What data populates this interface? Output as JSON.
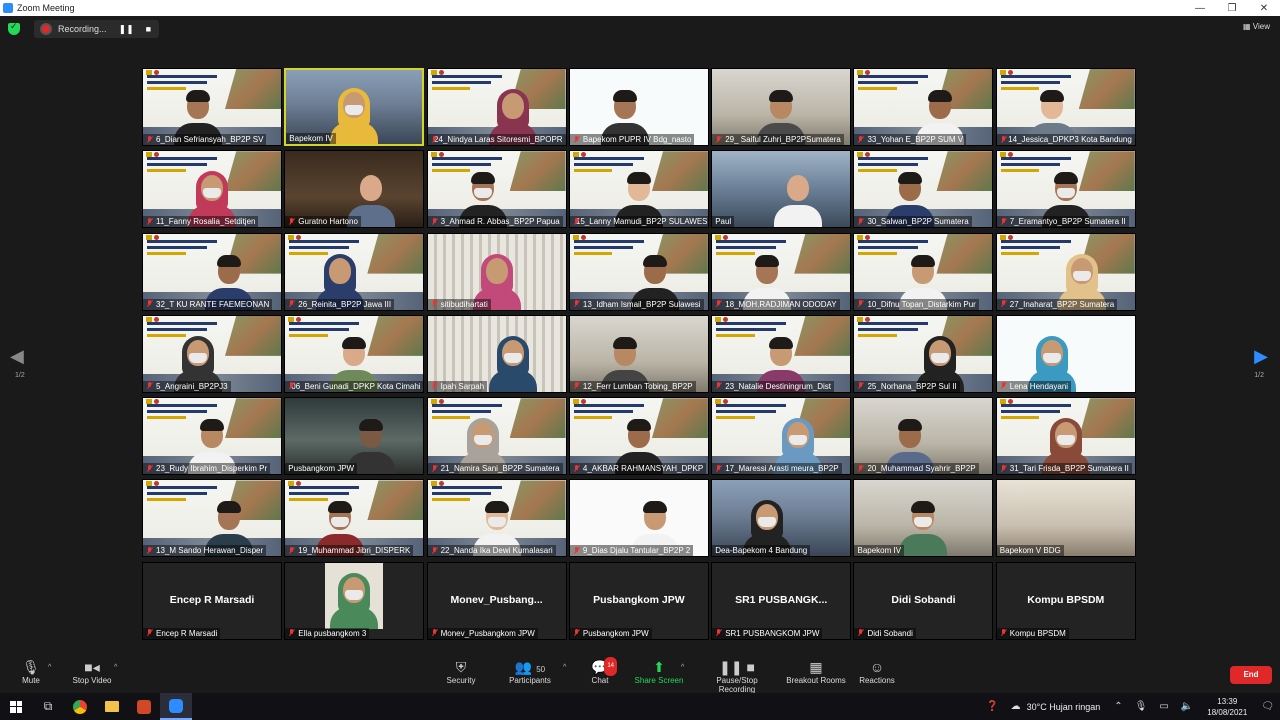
{
  "window": {
    "title": "Zoom Meeting",
    "controls": [
      "—",
      "❐",
      "✕"
    ]
  },
  "topbar": {
    "recording_label": "Recording...",
    "pause_icon": "pause-icon",
    "stop_icon": "stop-icon",
    "view_label": "View"
  },
  "pagination": {
    "left": "1/2",
    "right": "1/2"
  },
  "tiles": [
    {
      "label": "6_Dian Sefriansyah_BP2P SV",
      "bg": "banner",
      "muted": true,
      "person": {
        "skin": "#a67555",
        "hair": true,
        "shirt": "#222"
      }
    },
    {
      "label": "Bapekom IV",
      "bg": "building",
      "muted": false,
      "active": true,
      "person": {
        "skin": "#c79a74",
        "hijab": "#e8b93a",
        "shirt": "#e8b93a",
        "mask": true
      }
    },
    {
      "label": "24_Nindya Laras Sitoresmi_BPOPR",
      "bg": "banner",
      "muted": true,
      "person": {
        "skin": "#c79a74",
        "hijab": "#8a3550",
        "shirt": "#8a3550"
      }
    },
    {
      "label": "Bapekom PUPR IV Bdg_nasto",
      "bg": "slide",
      "muted": true,
      "person": {
        "skin": "#a67555",
        "hair": true,
        "shirt": "#333"
      }
    },
    {
      "label": "29_ Saiful Zuhri_BP2PSumatera",
      "bg": "room",
      "muted": true,
      "person": {
        "skin": "#b88863",
        "hair": true,
        "shirt": "#4a4a4a"
      }
    },
    {
      "label": "33_Yohan E_BP2P SUM V",
      "bg": "banner",
      "muted": true,
      "person": {
        "skin": "#9c6b4a",
        "hair": true,
        "shirt": "#f2f2f2"
      }
    },
    {
      "label": "14_Jessica_DPKP3 Kota Bandung",
      "bg": "banner",
      "muted": true,
      "person": {
        "skin": "#e2b896",
        "hair": true,
        "shirt": "#6c7a8a"
      }
    },
    {
      "label": "11_Fanny Rosalia_Setditjen",
      "bg": "banner",
      "muted": true,
      "person": {
        "skin": "#c79a74",
        "hijab": "#c23a5a",
        "shirt": "#c23a5a",
        "mask": true
      }
    },
    {
      "label": "Guratno Hartono",
      "bg": "dark",
      "muted": true,
      "person": {
        "skin": "#d9a98a",
        "hair": false,
        "shirt": "#5d6f8a"
      }
    },
    {
      "label": "3_Ahmad R. Abbas_BP2P Papua",
      "bg": "banner",
      "muted": true,
      "person": {
        "skin": "#a67555",
        "hair": true,
        "shirt": "#222",
        "mask": true
      }
    },
    {
      "label": "15_Lanny Mamudi_BP2P SULAWESI",
      "bg": "banner",
      "muted": true,
      "person": {
        "skin": "#e2b896",
        "hair": true,
        "shirt": "#222"
      }
    },
    {
      "label": "Paul",
      "bg": "city",
      "muted": false,
      "person": {
        "skin": "#d9a98a",
        "hair": false,
        "shirt": "#f2f2f2"
      }
    },
    {
      "label": "30_Salwan_BP2P Sumatera",
      "bg": "banner",
      "muted": true,
      "person": {
        "skin": "#9c6b4a",
        "hair": true,
        "shirt": "#2a3d6b"
      }
    },
    {
      "label": "7_Eramantyo_BP2P Sumatera II",
      "bg": "banner",
      "muted": true,
      "person": {
        "skin": "#a67555",
        "hair": true,
        "shirt": "#222",
        "mask": true
      }
    },
    {
      "label": "32_T KU RANTE FAEMEONAN",
      "bg": "banner",
      "muted": true,
      "person": {
        "skin": "#9c6b4a",
        "hair": true,
        "shirt": "#2a3d6b"
      }
    },
    {
      "label": "26_Reinita_BP2P Jawa III",
      "bg": "banner",
      "muted": true,
      "person": {
        "skin": "#c79a74",
        "hijab": "#2a3d6b",
        "shirt": "#2a3d6b"
      }
    },
    {
      "label": "sitibudihartati",
      "bg": "window",
      "muted": true,
      "person": {
        "skin": "#c79a74",
        "hijab": "#c24a7a",
        "shirt": "#c24a7a"
      }
    },
    {
      "label": "13_Idham Ismail_BP2P Sulawesi",
      "bg": "banner",
      "muted": true,
      "person": {
        "skin": "#9c6b4a",
        "hair": true,
        "shirt": "#222"
      }
    },
    {
      "label": "18_MOH.RADJIMAN ODODAY",
      "bg": "banner",
      "muted": true,
      "person": {
        "skin": "#a67555",
        "hair": true,
        "shirt": "#f2f2f2"
      }
    },
    {
      "label": "10_Difnu Topan_Distarkim Pur",
      "bg": "banner",
      "muted": true,
      "person": {
        "skin": "#c79a74",
        "hair": true,
        "shirt": "#f2f2f2"
      }
    },
    {
      "label": "27_Inaharat_BP2P Sumatera",
      "bg": "banner",
      "muted": true,
      "person": {
        "skin": "#c79a74",
        "hijab": "#e2c28a",
        "shirt": "#e2c28a",
        "mask": true
      }
    },
    {
      "label": "5_Angraini_BP2PJ3",
      "bg": "banner",
      "muted": true,
      "person": {
        "skin": "#c79a74",
        "hijab": "#333",
        "shirt": "#333",
        "mask": true
      }
    },
    {
      "label": "06_Beni Gunadi_DPKP Kota Cimahi",
      "bg": "banner",
      "muted": true,
      "person": {
        "skin": "#d9a98a",
        "hair": true,
        "shirt": "#6f8a5a"
      }
    },
    {
      "label": "Ipah Sarpah",
      "bg": "window",
      "muted": true,
      "person": {
        "skin": "#c79a74",
        "hijab": "#2a4a6b",
        "shirt": "#2a4a6b",
        "mask": true
      }
    },
    {
      "label": "12_Ferr Lumban Tobing_BP2P",
      "bg": "room",
      "muted": true,
      "person": {
        "skin": "#b88863",
        "hair": true,
        "shirt": "#444"
      }
    },
    {
      "label": "23_Natalie Destiningrum_Dist",
      "bg": "banner",
      "muted": true,
      "person": {
        "skin": "#c79a74",
        "hair": true,
        "shirt": "#8a3a6a"
      }
    },
    {
      "label": "25_Norhana_BP2P Sul II",
      "bg": "banner",
      "muted": true,
      "person": {
        "skin": "#c79a74",
        "hijab": "#222",
        "shirt": "#222",
        "mask": true
      }
    },
    {
      "label": "Lena Hendayani",
      "bg": "slide",
      "muted": true,
      "person": {
        "skin": "#c79a74",
        "hijab": "#3a9ac2",
        "shirt": "#3a9ac2",
        "mask": true
      }
    },
    {
      "label": "23_Rudy Ibrahim_Disperkim Pr",
      "bg": "banner",
      "muted": true,
      "person": {
        "skin": "#b88863",
        "hair": true,
        "shirt": "#f2f2f2"
      }
    },
    {
      "label": "Pusbangkom JPW",
      "bg": "room2",
      "muted": false,
      "person": {
        "skin": "#7a5a44",
        "hair": true,
        "shirt": "#333"
      }
    },
    {
      "label": "21_Namira Sani_BP2P Sumatera",
      "bg": "banner",
      "muted": true,
      "person": {
        "skin": "#c79a74",
        "hijab": "#a8a29a",
        "shirt": "#a8a29a",
        "mask": true
      }
    },
    {
      "label": "4_AKBAR RAHMANSYAH_DPKP",
      "bg": "banner",
      "muted": true,
      "person": {
        "skin": "#9c6b4a",
        "hair": true,
        "shirt": "#222"
      }
    },
    {
      "label": "17_Maressi Arasti meura_BP2P",
      "bg": "banner",
      "muted": true,
      "person": {
        "skin": "#c79a74",
        "hijab": "#6a9ac2",
        "shirt": "#6a9ac2",
        "mask": true
      }
    },
    {
      "label": "20_Muhammad Syahrir_BP2P",
      "bg": "room",
      "muted": true,
      "person": {
        "skin": "#9c6b4a",
        "hair": true,
        "shirt": "#5a6a8a"
      }
    },
    {
      "label": "31_Tari Frisda_BP2P Sumatera II",
      "bg": "banner",
      "muted": true,
      "person": {
        "skin": "#c79a74",
        "hijab": "#8a4a3a",
        "shirt": "#8a4a3a",
        "mask": true
      }
    },
    {
      "label": "13_M Sando Herawan_Disper",
      "bg": "banner",
      "muted": true,
      "person": {
        "skin": "#a67555",
        "hair": true,
        "shirt": "#2a3d4a"
      }
    },
    {
      "label": "19_Muhammad Jibri_DISPERK",
      "bg": "banner",
      "muted": true,
      "person": {
        "skin": "#a67555",
        "hair": true,
        "shirt": "#8a2a2a",
        "mask": true
      }
    },
    {
      "label": "22_Nanda Ika Dewi Kumalasari",
      "bg": "banner",
      "muted": true,
      "person": {
        "skin": "#e2b896",
        "hair": true,
        "shirt": "#f2f2f2",
        "mask": true
      }
    },
    {
      "label": "9_Dias Djalu Tantular_BP2P 2",
      "bg": "blank",
      "muted": true,
      "person": {
        "skin": "#c79a74",
        "hair": true,
        "shirt": "#f2f2f2"
      }
    },
    {
      "label": "Dea-Bapekom 4 Bandung",
      "bg": "building",
      "muted": false,
      "person": {
        "skin": "#c79a74",
        "hijab": "#222",
        "shirt": "#222",
        "mask": true
      }
    },
    {
      "label": "Bapekom IV",
      "bg": "room",
      "muted": false,
      "person": {
        "skin": "#b88863",
        "hair": true,
        "shirt": "#4a7a5a",
        "mask": true
      }
    },
    {
      "label": "Bapekom V BDG",
      "bg": "flags",
      "muted": false,
      "person": null
    },
    {
      "label": "Encep R Marsadi",
      "bg": "name",
      "muted": true,
      "center_name": "Encep R Marsadi",
      "person": null
    },
    {
      "label": "Ella pusbangkom 3",
      "bg": "name",
      "muted": true,
      "person": null,
      "inset": {
        "skin": "#c79a74",
        "hijab": "#4a8a5a",
        "shirt": "#4a8a5a",
        "mask": true
      }
    },
    {
      "label": "Monev_Pusbangkom JPW",
      "bg": "name",
      "muted": true,
      "center_name": "Monev_Pusbang...",
      "person": null
    },
    {
      "label": "Pusbangkom JPW",
      "bg": "name",
      "muted": true,
      "center_name": "Pusbangkom JPW",
      "person": null
    },
    {
      "label": "SR1 PUSBANGKOM JPW",
      "bg": "name",
      "muted": true,
      "center_name": "SR1 PUSBANGK...",
      "person": null
    },
    {
      "label": "Didi Sobandi",
      "bg": "name",
      "muted": true,
      "center_name": "Didi Sobandi",
      "person": null
    },
    {
      "label": "Kompu BPSDM",
      "bg": "name",
      "muted": true,
      "center_name": "Kompu BPSDM",
      "person": null
    }
  ],
  "toolbar": {
    "mute": "Mute",
    "stop_video": "Stop Video",
    "security": "Security",
    "participants": "Participants",
    "participants_count": "50",
    "chat": "Chat",
    "chat_badge": "14",
    "share_screen": "Share Screen",
    "pause_recording": "Pause/Stop Recording",
    "breakout_rooms": "Breakout Rooms",
    "reactions": "Reactions",
    "end": "End"
  },
  "taskbar": {
    "weather": "30°C  Hujan ringan",
    "time": "13:39",
    "date": "18/08/2021"
  }
}
